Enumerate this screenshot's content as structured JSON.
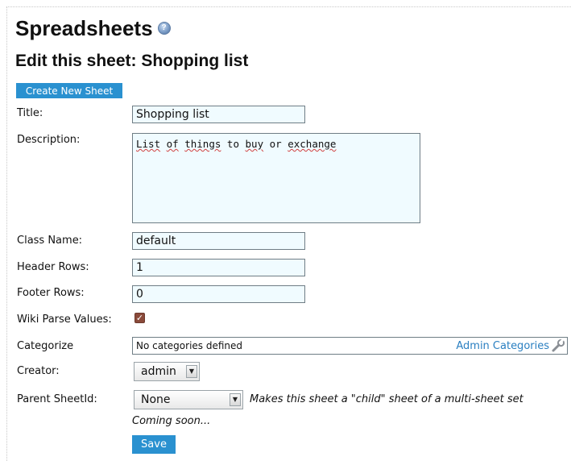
{
  "page": {
    "title": "Spreadsheets",
    "subtitle": "Edit this sheet: Shopping list"
  },
  "toolbar": {
    "create_label": "Create New Sheet"
  },
  "form": {
    "title_label": "Title:",
    "title_value": "Shopping list",
    "description_label": "Description:",
    "description_words": [
      "List",
      "of",
      "things",
      "to",
      "buy",
      "or",
      "exchange"
    ],
    "classname_label": "Class Name:",
    "classname_value": "default",
    "header_rows_label": "Header Rows:",
    "header_rows_value": "1",
    "footer_rows_label": "Footer Rows:",
    "footer_rows_value": "0",
    "wiki_parse_label": "Wiki Parse Values:",
    "wiki_parse_checked": true,
    "categorize_label": "Categorize",
    "categorize_text": "No categories defined",
    "admin_categories_link": "Admin Categories",
    "creator_label": "Creator:",
    "creator_value": "admin",
    "parent_label": "Parent SheetId:",
    "parent_value": "None",
    "parent_hint": "Makes this sheet a \"child\" sheet of a multi-sheet set",
    "coming_soon": "Coming soon...",
    "save_label": "Save"
  },
  "icons": {
    "help": "help-icon",
    "wrench": "wrench-icon",
    "dropdown": "chevron-down-icon"
  },
  "colors": {
    "accent": "#2a91d0",
    "link": "#2a7fc1",
    "input_bg": "#f0fbff",
    "checkbox": "#8a4a3a"
  }
}
